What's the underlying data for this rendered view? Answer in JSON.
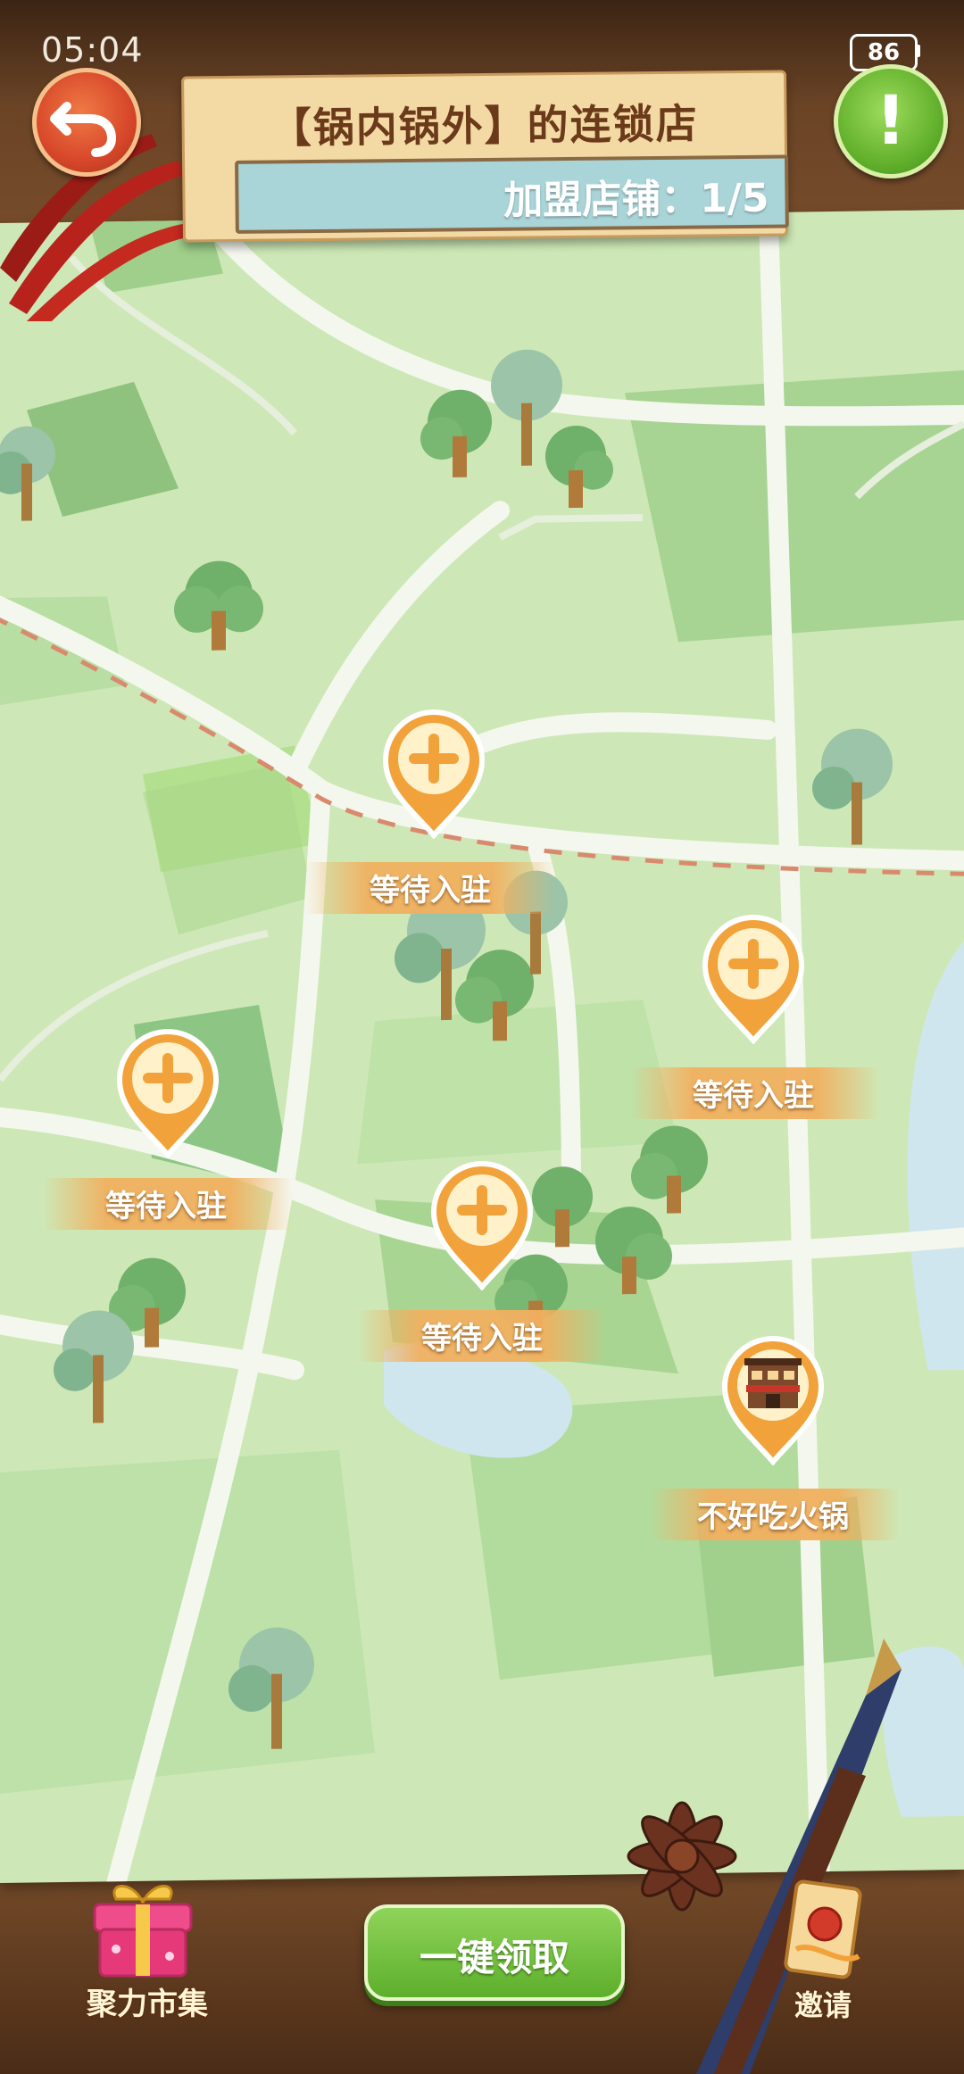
{
  "status_bar": {
    "time": "05:04",
    "battery": "86"
  },
  "header": {
    "title": "【锅内锅外】的连锁店",
    "franchise_label": "加盟店铺：",
    "franchise_count": "1/5"
  },
  "map": {
    "pins": [
      {
        "label": "等待入驻",
        "state": "empty-slot",
        "icon": "plus-icon"
      },
      {
        "label": "等待入驻",
        "state": "empty-slot",
        "icon": "plus-icon"
      },
      {
        "label": "等待入驻",
        "state": "empty-slot",
        "icon": "plus-icon"
      },
      {
        "label": "等待入驻",
        "state": "empty-slot",
        "icon": "plus-icon"
      },
      {
        "label": "不好吃火锅",
        "state": "occupied",
        "icon": "shop-building-icon"
      }
    ]
  },
  "bottom_bar": {
    "market_label": "聚力市集",
    "claim_all_label": "一键领取",
    "invite_label": "邀请"
  },
  "colors": {
    "accent_orange": "#f2a23a",
    "claim_green": "#5daf2c",
    "back_red": "#d7472a"
  }
}
